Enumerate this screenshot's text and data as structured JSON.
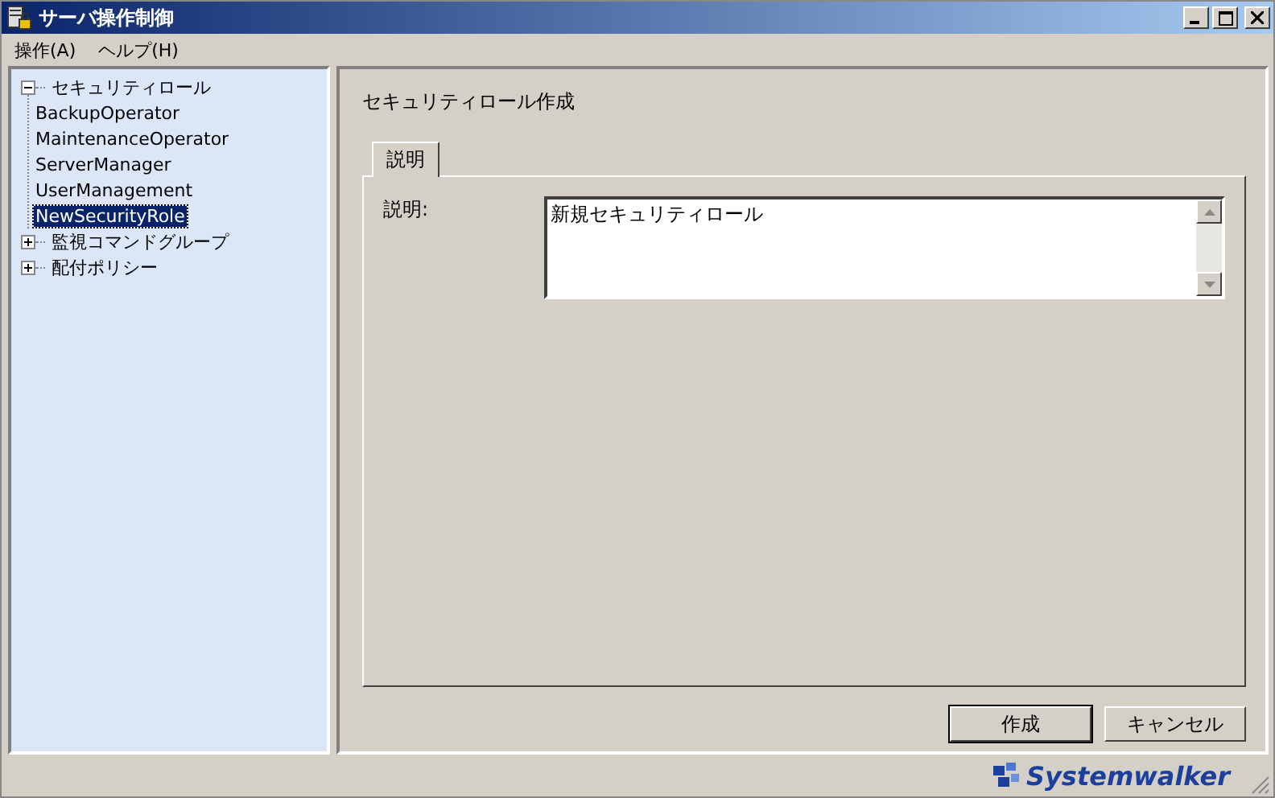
{
  "window": {
    "title": "サーバ操作制御"
  },
  "menu": [
    {
      "label": "操作(A)"
    },
    {
      "label": "ヘルプ(H)"
    }
  ],
  "tree": [
    {
      "label": "セキュリティロール",
      "expanded": true,
      "selected": false,
      "children": [
        {
          "label": "BackupOperator",
          "selected": false
        },
        {
          "label": "MaintenanceOperator",
          "selected": false
        },
        {
          "label": "ServerManager",
          "selected": false
        },
        {
          "label": "UserManagement",
          "selected": false
        },
        {
          "label": "NewSecurityRole",
          "selected": true
        }
      ]
    },
    {
      "label": "監視コマンドグループ",
      "expanded": false,
      "selected": false
    },
    {
      "label": "配付ポリシー",
      "expanded": false,
      "selected": false
    }
  ],
  "form": {
    "heading": "セキュリティロール作成",
    "tabs": [
      {
        "label": "説明",
        "selected": true
      }
    ],
    "field_label": "説明:",
    "description": "新規セキュリティロール"
  },
  "buttons": [
    {
      "label": "作成",
      "default": true
    },
    {
      "label": "キャンセル",
      "default": false
    }
  ],
  "brand": "Systemwalker"
}
